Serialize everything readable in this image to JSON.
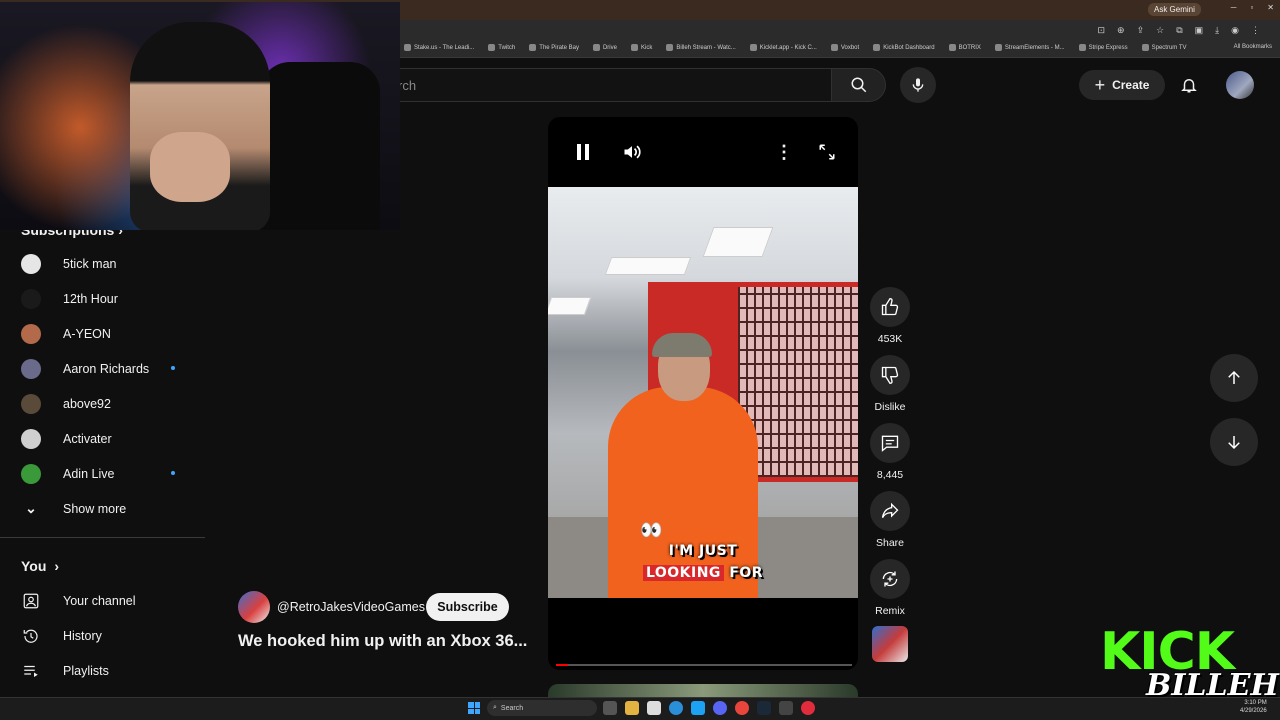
{
  "browser": {
    "ask_gemini": "Ask Gemini",
    "bookmarks": [
      "Stake.us - The Leadi...",
      "Twitch",
      "The Pirate Bay",
      "Drive",
      "Kick",
      "Billeh Stream - Watc...",
      "Kicklet.app - Kick C...",
      "Voxbot",
      "KickBot Dashboard",
      "BOTRIX",
      "StreamElements - M...",
      "Stripe Express",
      "Spectrum TV"
    ],
    "all_bookmarks": "All Bookmarks"
  },
  "header": {
    "search_placeholder": "rch",
    "create_label": "Create"
  },
  "sidebar": {
    "subscriptions_title": "Subscriptions",
    "subscriptions": [
      {
        "name": "5tick man",
        "live": false,
        "avatar_color": "#e6e6e6"
      },
      {
        "name": "12th Hour",
        "live": false,
        "avatar_color": "#1a1a1a"
      },
      {
        "name": "A-YEON",
        "live": false,
        "avatar_color": "#b36a4a"
      },
      {
        "name": "Aaron Richards",
        "live": true,
        "avatar_color": "#6a6a8a"
      },
      {
        "name": "above92",
        "live": false,
        "avatar_color": "#5a4a3a"
      },
      {
        "name": "Activater",
        "live": false,
        "avatar_color": "#cfcfcf"
      },
      {
        "name": "Adin Live",
        "live": true,
        "avatar_color": "#3a9a3a"
      }
    ],
    "show_more": "Show more",
    "you_title": "You",
    "you_items": [
      {
        "name": "Your channel",
        "icon": "person-icon"
      },
      {
        "name": "History",
        "icon": "history-icon"
      },
      {
        "name": "Playlists",
        "icon": "playlist-icon"
      }
    ]
  },
  "short": {
    "caption_line1": "I'M JUST",
    "caption_highlight": "LOOKING",
    "caption_rest": "FOR",
    "progress": 0.04,
    "like_count": "453K",
    "dislike_label": "Dislike",
    "comment_count": "8,445",
    "share_label": "Share",
    "remix_label": "Remix",
    "channel_handle": "@RetroJakesVideoGames",
    "subscribe_label": "Subscribe",
    "title": "We hooked him up with an Xbox 36..."
  },
  "overlay": {
    "logo_top": "KICK",
    "logo_bottom": "BILLEH"
  },
  "taskbar": {
    "search_label": "Search",
    "time": "3:10 PM",
    "date": "4/29/2026"
  }
}
